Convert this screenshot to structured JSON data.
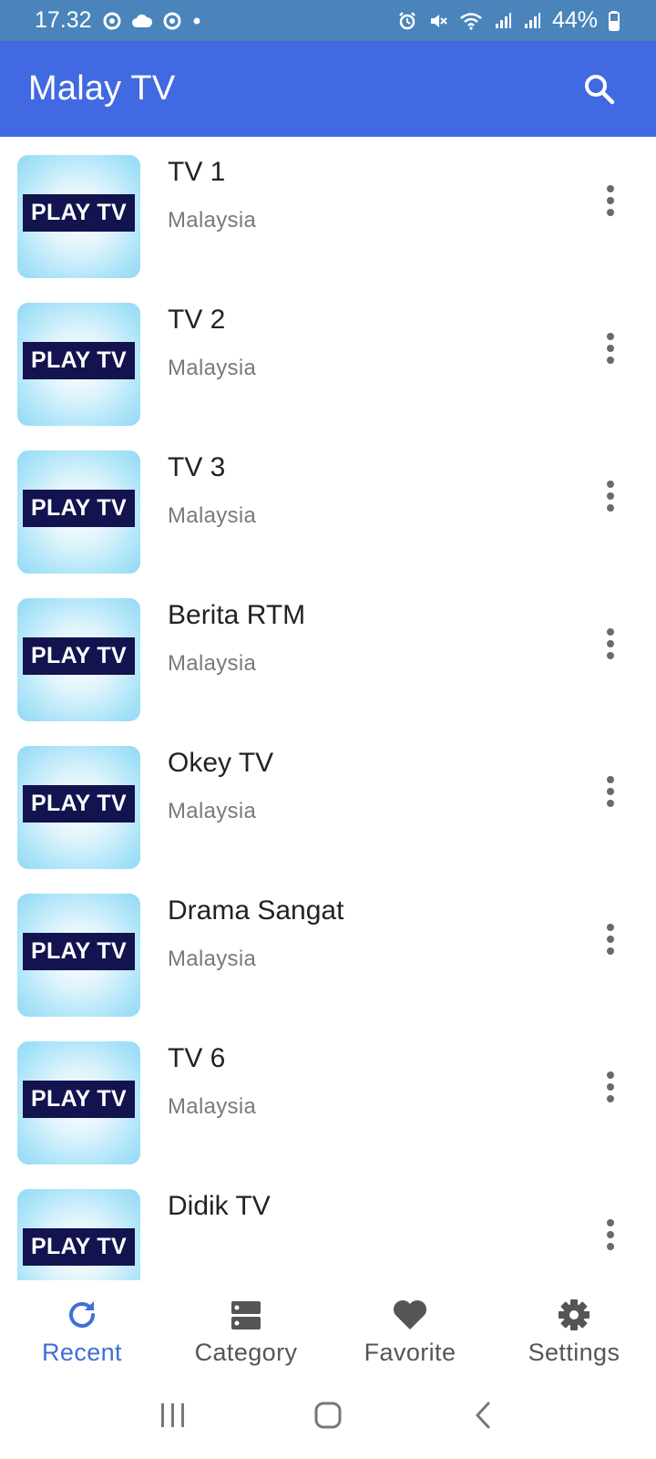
{
  "status_bar": {
    "time": "17.32",
    "battery": "44%",
    "icons_left": [
      "location-icon",
      "cloud-icon",
      "location-icon",
      "dot-icon"
    ],
    "icons_right": [
      "alarm-icon",
      "mute-icon",
      "wifi-icon",
      "signal-icon",
      "signal-icon",
      "battery-icon"
    ]
  },
  "app_bar": {
    "title": "Malay TV",
    "search_icon": "search-icon"
  },
  "channels": [
    {
      "name": "TV 1",
      "country": "Malaysia",
      "thumb_label": "PLAY TV"
    },
    {
      "name": "TV 2",
      "country": "Malaysia",
      "thumb_label": "PLAY TV"
    },
    {
      "name": "TV 3",
      "country": "Malaysia",
      "thumb_label": "PLAY TV"
    },
    {
      "name": "Berita RTM",
      "country": "Malaysia",
      "thumb_label": "PLAY TV"
    },
    {
      "name": "Okey TV",
      "country": "Malaysia",
      "thumb_label": "PLAY TV"
    },
    {
      "name": "Drama Sangat",
      "country": "Malaysia",
      "thumb_label": "PLAY TV"
    },
    {
      "name": "TV 6",
      "country": "Malaysia",
      "thumb_label": "PLAY TV"
    },
    {
      "name": "Didik TV",
      "country": "",
      "thumb_label": "PLAY TV"
    }
  ],
  "bottom_nav": {
    "items": [
      {
        "label": "Recent",
        "icon": "refresh-icon",
        "active": true
      },
      {
        "label": "Category",
        "icon": "category-icon",
        "active": false
      },
      {
        "label": "Favorite",
        "icon": "heart-icon",
        "active": false
      },
      {
        "label": "Settings",
        "icon": "gear-icon",
        "active": false
      }
    ]
  },
  "colors": {
    "status_bar": "#4a84bb",
    "app_bar": "#4169e1",
    "active_nav": "#3f6fd6",
    "inactive_nav": "#555555",
    "thumb_label_bg": "#13134f"
  }
}
